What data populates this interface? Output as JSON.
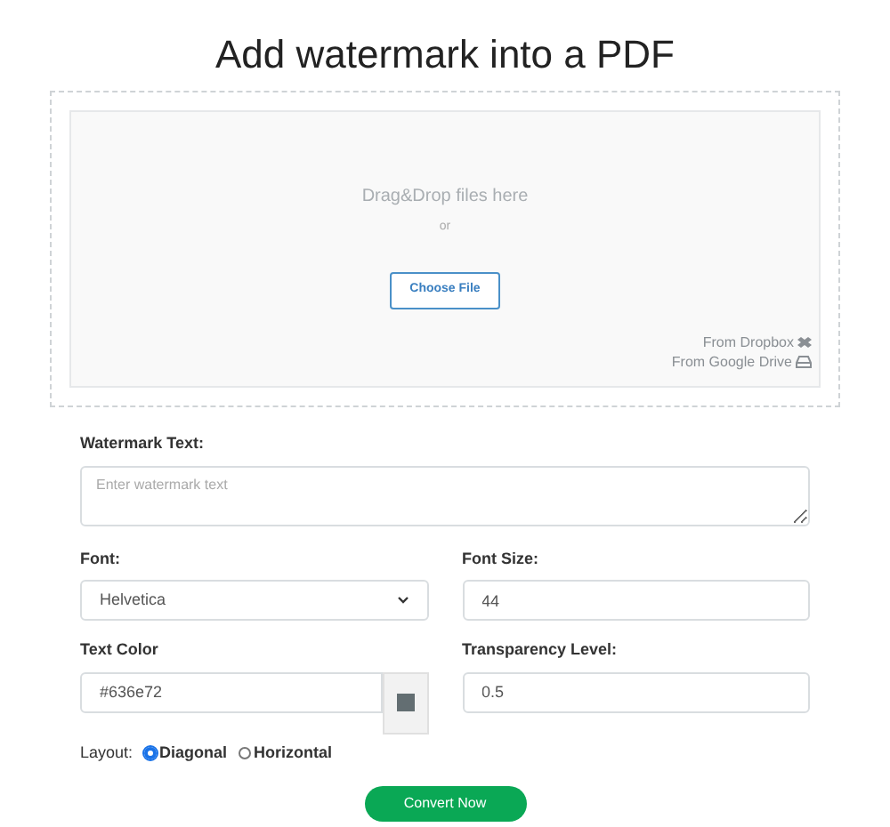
{
  "title": "Add watermark into a PDF",
  "dropzone": {
    "prompt": "Drag&Drop files here",
    "separator": "or",
    "button": "Choose File",
    "sources": [
      {
        "label": "From Dropbox",
        "kind": "dropbox"
      },
      {
        "label": "From Google Drive",
        "kind": "drive"
      }
    ]
  },
  "watermark_text": {
    "label": "Watermark Text:",
    "placeholder": "Enter watermark text"
  },
  "font": {
    "label": "Font:",
    "value": "Helvetica"
  },
  "font_size": {
    "label": "Font Size:",
    "value": "44"
  },
  "text_color": {
    "label": "Text Color",
    "value": "#636e72",
    "color": "#636e72"
  },
  "transparency": {
    "label": "Transparency Level:",
    "value": "0.5"
  },
  "layout": {
    "label": "Layout:",
    "options": [
      {
        "label": "Diagonal",
        "selected": true
      },
      {
        "label": "Horizontal",
        "selected": false
      }
    ]
  },
  "submit": "Convert Now"
}
